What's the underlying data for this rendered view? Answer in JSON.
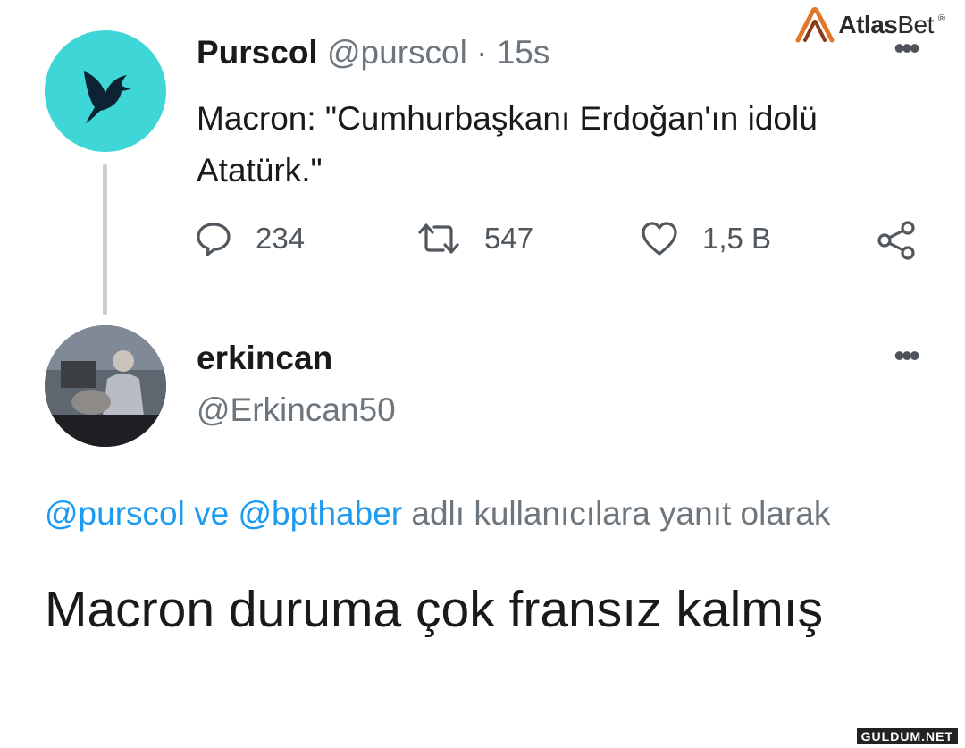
{
  "watermark": {
    "brand_a": "Atlas",
    "brand_b": "Bet",
    "reg": "®",
    "corner": "GULDUM.NET"
  },
  "tweet1": {
    "name": "Purscol",
    "handle": "@purscol",
    "sep": "·",
    "time": "15s",
    "text": "Macron: \"Cumhurbaşkanı Erdoğan'ın idolü Atatürk.\"",
    "replies": "234",
    "retweets": "547",
    "likes": "1,5 B",
    "more": "•••",
    "avatar_color": "#3fd6d8"
  },
  "tweet2": {
    "name": "erkincan",
    "handle": "@Erkincan50",
    "more": "•••",
    "reply_to": {
      "user1": "@purscol",
      "conj": "ve",
      "user2": "@bpthaber",
      "suffix": "adlı kullanıcılara yanıt olarak"
    },
    "text": "Macron duruma çok fransız kalmış"
  },
  "colors": {
    "link": "#1d9bf0",
    "muted": "#6e767d",
    "thread_line": "#c7cdd2"
  }
}
